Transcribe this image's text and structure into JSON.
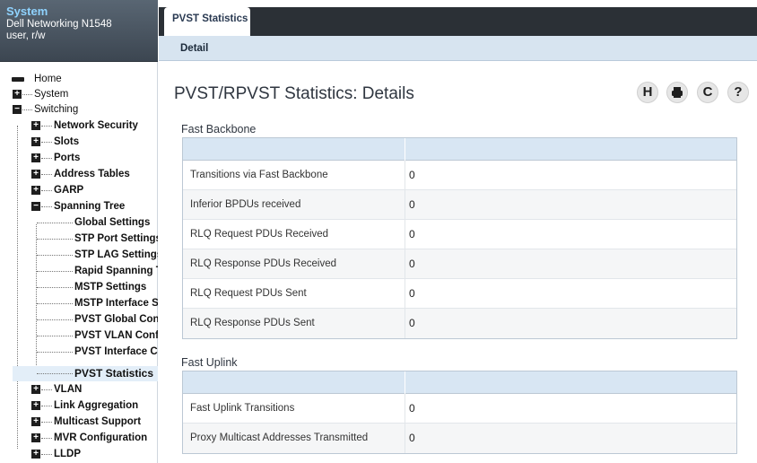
{
  "system": {
    "title": "System",
    "model": "Dell Networking N1548",
    "user": "user, r/w"
  },
  "nav": {
    "home": "Home",
    "system": "System",
    "switching": "Switching",
    "network_security": "Network Security",
    "slots": "Slots",
    "ports": "Ports",
    "address_tables": "Address Tables",
    "garp": "GARP",
    "spanning_tree": "Spanning Tree",
    "global_settings": "Global Settings",
    "stp_port_settings": "STP Port Settings",
    "stp_lag_settings": "STP LAG Settings",
    "rapid_spanning_tree": "Rapid Spanning Tre",
    "mstp_settings": "MSTP Settings",
    "mstp_interface_settings": "MSTP Interface Sett",
    "pvst_global_config": "PVST Global Config",
    "pvst_vlan_config": "PVST VLAN Configu",
    "pvst_interface_config": "PVST Interface Con",
    "pvst_statistics": "PVST Statistics",
    "vlan": "VLAN",
    "link_aggregation": "Link Aggregation",
    "multicast_support": "Multicast Support",
    "mvr_configuration": "MVR Configuration",
    "lldp": "LLDP"
  },
  "tabs": {
    "active": "PVST Statistics",
    "sub": "Detail"
  },
  "page": {
    "title": "PVST/RPVST Statistics: Details"
  },
  "toolbar": {
    "save_icon": "H",
    "print_icon": "print",
    "refresh_icon": "C",
    "help_icon": "?"
  },
  "fast_backbone": {
    "title": "Fast Backbone",
    "rows": [
      {
        "label": "Transitions via Fast Backbone",
        "value": "0"
      },
      {
        "label": "Inferior BPDUs received",
        "value": "0"
      },
      {
        "label": "RLQ Request PDUs Received",
        "value": "0"
      },
      {
        "label": "RLQ Response PDUs Received",
        "value": "0"
      },
      {
        "label": "RLQ Request PDUs Sent",
        "value": "0"
      },
      {
        "label": "RLQ Response PDUs Sent",
        "value": "0"
      }
    ]
  },
  "fast_uplink": {
    "title": "Fast Uplink",
    "rows": [
      {
        "label": "Fast Uplink Transitions",
        "value": "0"
      },
      {
        "label": "Proxy Multicast Addresses Transmitted",
        "value": "0"
      }
    ]
  }
}
